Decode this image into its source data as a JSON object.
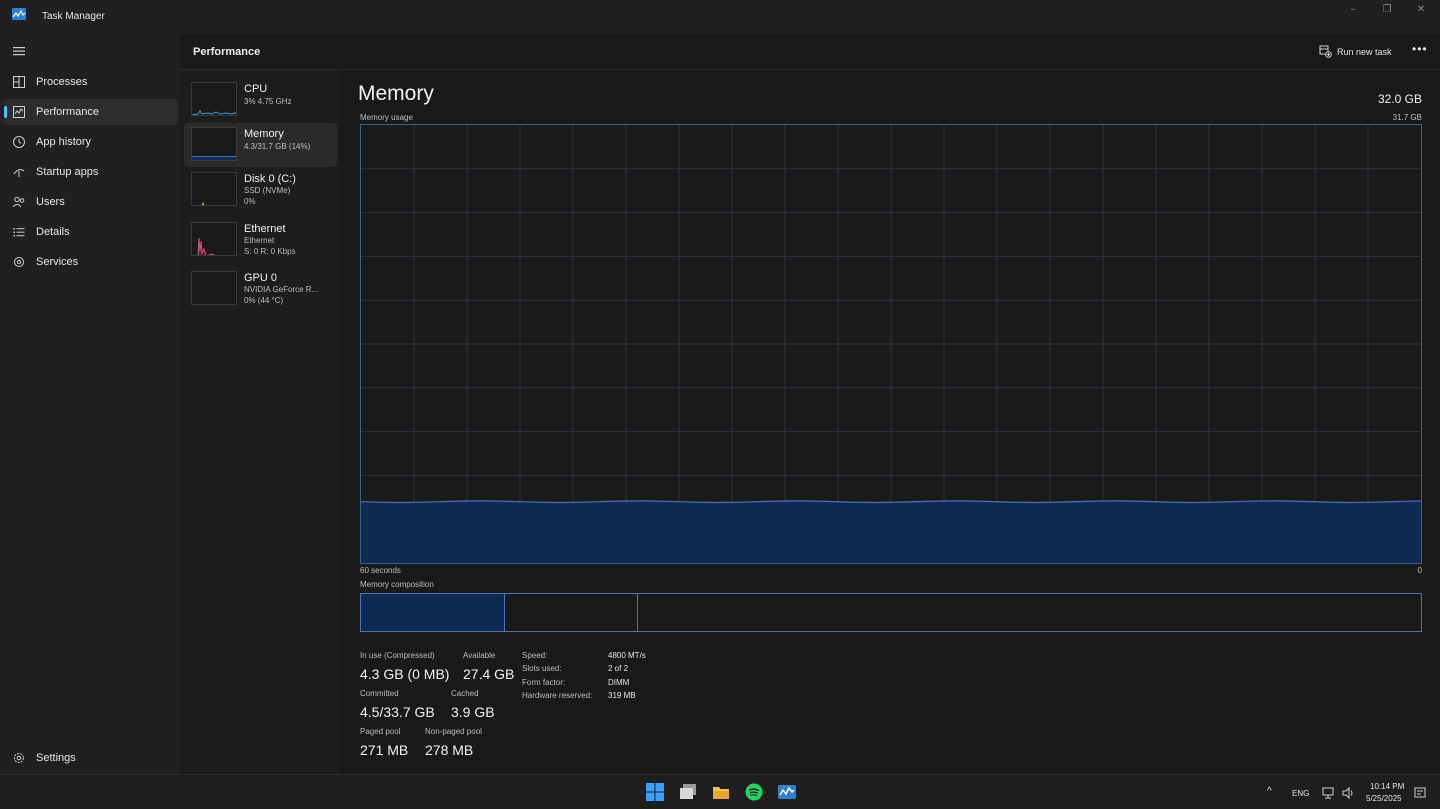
{
  "window": {
    "title": "Task Manager",
    "controls": {
      "minimize": "–",
      "maximize": "❐",
      "close": "✕"
    }
  },
  "sidebar": {
    "items": [
      {
        "label": "Processes",
        "icon": "processes-icon"
      },
      {
        "label": "Performance",
        "icon": "performance-icon",
        "active": true
      },
      {
        "label": "App history",
        "icon": "history-icon"
      },
      {
        "label": "Startup apps",
        "icon": "startup-icon"
      },
      {
        "label": "Users",
        "icon": "users-icon"
      },
      {
        "label": "Details",
        "icon": "details-icon"
      },
      {
        "label": "Services",
        "icon": "services-icon"
      }
    ],
    "settings_label": "Settings"
  },
  "header": {
    "title": "Performance",
    "run_new_task": "Run new task",
    "more": "•••"
  },
  "devices": [
    {
      "name": "CPU",
      "line1": "3% 4.75 GHz",
      "line2": ""
    },
    {
      "name": "Memory",
      "line1": "4.3/31.7 GB (14%)",
      "line2": "",
      "active": true
    },
    {
      "name": "Disk 0 (C:)",
      "line1": "SSD (NVMe)",
      "line2": "0%"
    },
    {
      "name": "Ethernet",
      "line1": "Ethernet",
      "line2": "S: 0 R: 0 Kbps"
    },
    {
      "name": "GPU 0",
      "line1": "NVIDIA GeForce R...",
      "line2": "0% (44 °C)"
    }
  ],
  "memory": {
    "title": "Memory",
    "total": "32.0 GB",
    "usage_label": "Memory usage",
    "usage_max": "31.7 GB",
    "time_label": "60 seconds",
    "time_end": "0",
    "composition_label": "Memory composition",
    "usage_fraction": 0.14,
    "composition": {
      "in_use_fraction": 0.136,
      "standby_end_fraction": 0.26
    },
    "stats": {
      "in_use_label": "In use (Compressed)",
      "in_use_value": "4.3 GB (0 MB)",
      "available_label": "Available",
      "available_value": "27.4 GB",
      "committed_label": "Committed",
      "committed_value": "4.5/33.7 GB",
      "cached_label": "Cached",
      "cached_value": "3.9 GB",
      "paged_label": "Paged pool",
      "paged_value": "271 MB",
      "nonpaged_label": "Non-paged pool",
      "nonpaged_value": "278 MB"
    },
    "specs": {
      "speed_key": "Speed:",
      "speed_val": "4800 MT/s",
      "slots_key": "Slots used:",
      "slots_val": "2 of 2",
      "form_key": "Form factor:",
      "form_val": "DIMM",
      "hw_key": "Hardware reserved:",
      "hw_val": "319 MB"
    }
  },
  "taskbar": {
    "apps": [
      "windows-start-icon",
      "task-view-icon",
      "file-explorer-icon",
      "spotify-icon",
      "task-manager-icon"
    ],
    "tray": {
      "chevron": "^",
      "lang": "ENG",
      "time": "10:14 PM",
      "date": "5/25/2025"
    }
  },
  "colors": {
    "accent": "#4cc2ff",
    "memory_line": "#4a74b0",
    "memory_fill": "#0f2a55"
  }
}
